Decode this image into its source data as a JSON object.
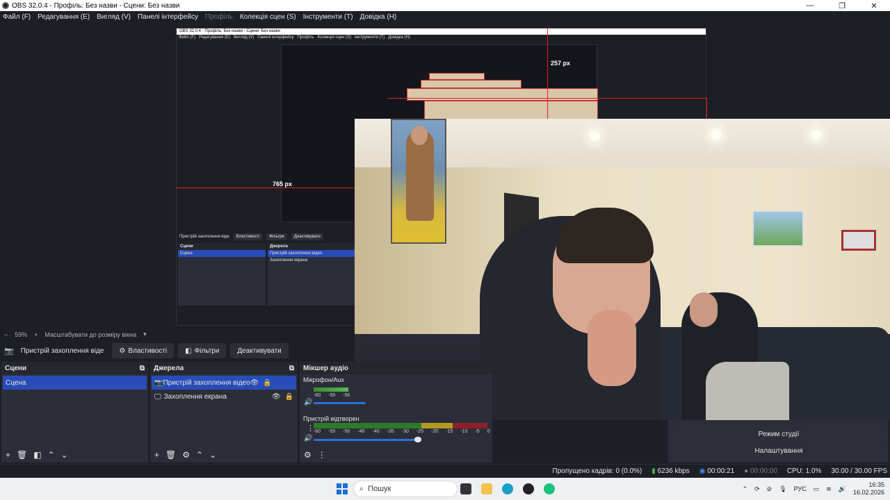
{
  "window": {
    "title": "OBS 32.0.4 - Профіль: Без назви - Сцени: Без назви"
  },
  "menu": {
    "file": "Файл (F)",
    "edit": "Редагування (E)",
    "view": "Вигляд (V)",
    "docks": "Панелі інтерфейсу",
    "profile": "Профіль",
    "scene_collection": "Колекція сцен (S)",
    "tools": "Інструменти (T)",
    "help": "Довідка (H)"
  },
  "preview": {
    "px_label_top": "257 px",
    "px_label_left": "765 px",
    "nested_title": "OBS 32.0.4 - Профіль: Без назви - Сцени: Без назви",
    "nested_px_top": "257 px",
    "nested_px_left": "765 px"
  },
  "zoom": {
    "minus": "−",
    "value": "59%",
    "plus": "+",
    "fit_label": "Масштабувати до розміру вікна"
  },
  "source_toolbar": {
    "source_name": "Пристрій захоплення віде",
    "properties": "Властивості",
    "filters": "Фільтри",
    "deactivate": "Деактивувати"
  },
  "scenes": {
    "header": "Сцени",
    "items": [
      "Сцена"
    ]
  },
  "sources": {
    "header": "Джерела",
    "items": [
      "Пристрій захоплення відео",
      "Захоплення екрана"
    ]
  },
  "mixer": {
    "header": "Мікшер аудіо",
    "mic_label": "Мікрофон/Aux",
    "mic_ticks": [
      "-60",
      "-55",
      "-50"
    ],
    "mic_level": 0.25,
    "desktop_label": "Пристрій відтворен",
    "desktop_ticks": [
      "-60",
      "-55",
      "-50",
      "-45",
      "-40",
      "-35",
      "-30",
      "-25",
      "-20",
      "-15",
      "-10",
      "-5",
      "0"
    ],
    "desktop_level": 0.5
  },
  "controls": {
    "studio_mode": "Режим студії",
    "settings": "Налаштування"
  },
  "status": {
    "dropped": "Пропущено кадрів: 0 (0.0%)",
    "bitrate": "6236 kbps",
    "stream_time": "00:00:21",
    "rec_time": "00:00:00",
    "cpu": "CPU: 1.0%",
    "fps": "30.00 / 30.00 FPS"
  },
  "taskbar": {
    "search_placeholder": "Пошук",
    "language": "РУС",
    "time": "16:35",
    "date": "16.02.2026"
  },
  "colors": {
    "accent": "#284cb8",
    "red_guide": "#e02020",
    "bg": "#1d1f26",
    "panel": "#2b2e38"
  }
}
